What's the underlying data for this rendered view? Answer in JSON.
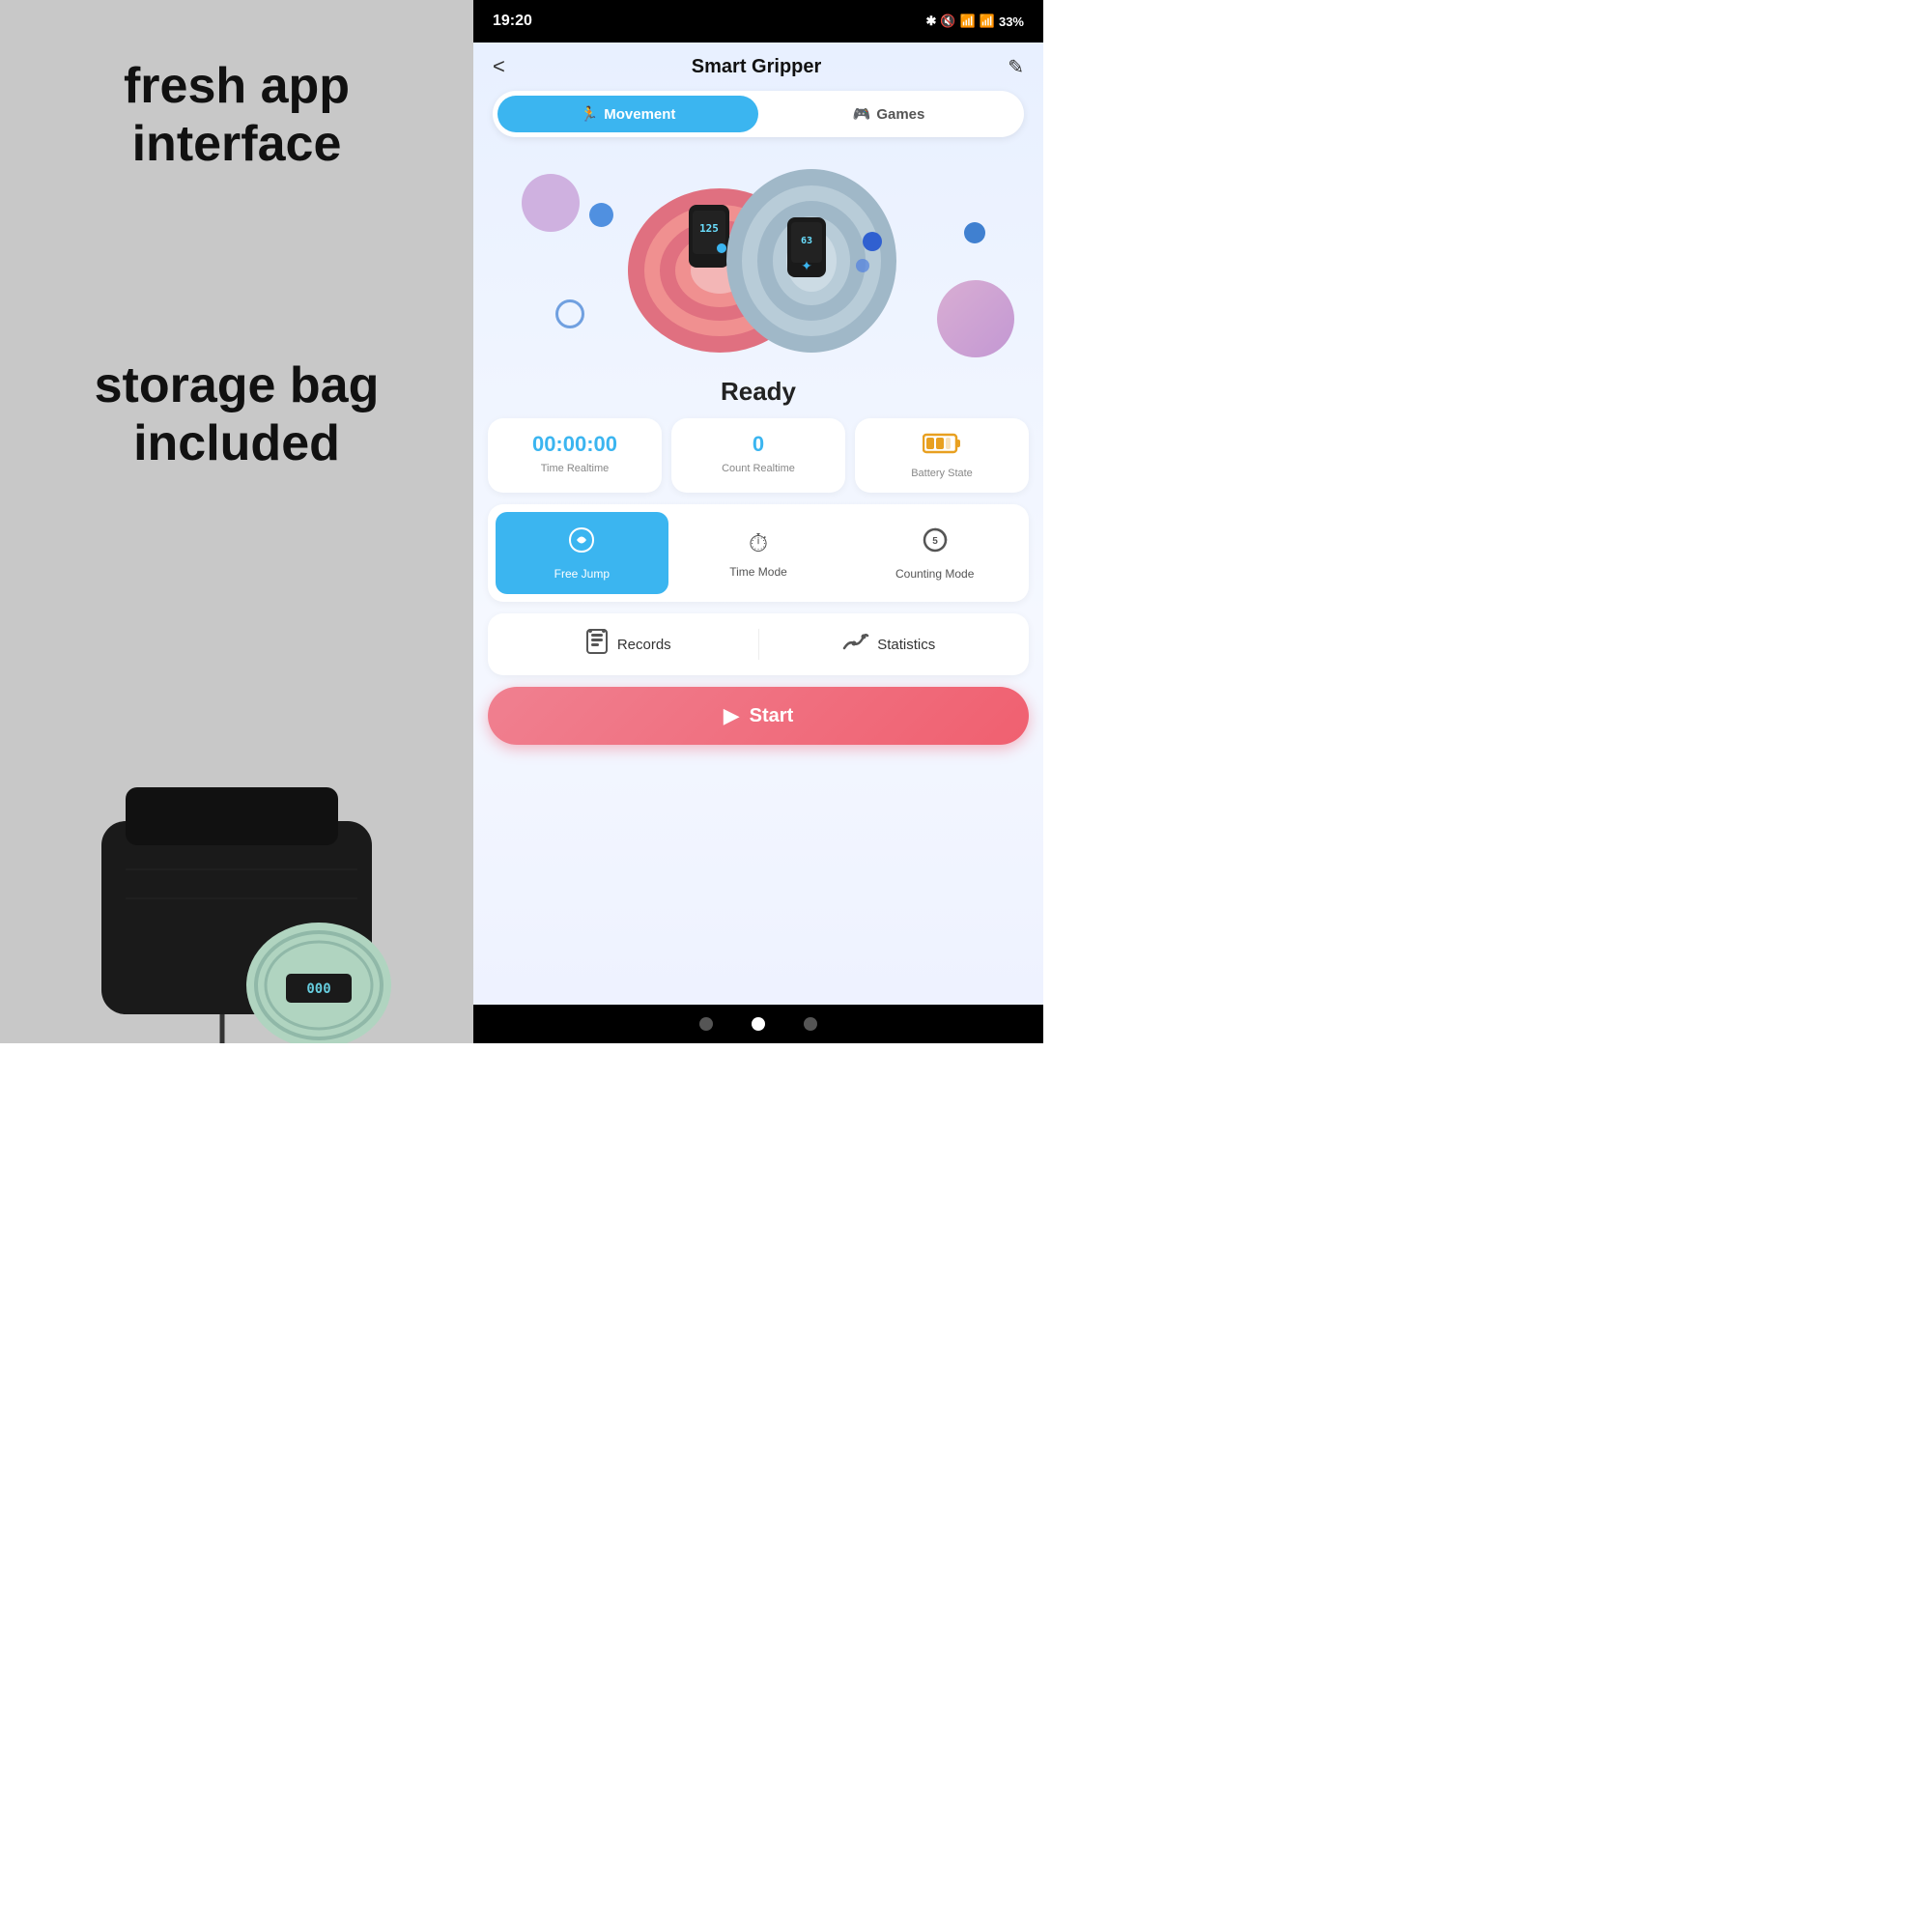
{
  "left": {
    "text_top": "fresh app interface",
    "text_bottom": "storage bag included"
  },
  "status_bar": {
    "time": "19:20",
    "battery": "33%"
  },
  "header": {
    "back": "<",
    "title": "Smart Gripper",
    "edit": "✎"
  },
  "tabs": [
    {
      "id": "movement",
      "label": "Movement",
      "icon": "🏃",
      "active": true
    },
    {
      "id": "games",
      "label": "Games",
      "icon": "🎮",
      "active": false
    }
  ],
  "device_status": "Ready",
  "stats": [
    {
      "id": "time",
      "value": "00:00:00",
      "label": "Time Realtime",
      "type": "text"
    },
    {
      "id": "count",
      "value": "0",
      "label": "Count Realtime",
      "type": "text"
    },
    {
      "id": "battery",
      "label": "Battery State",
      "type": "battery"
    }
  ],
  "modes": [
    {
      "id": "free-jump",
      "label": "Free Jump",
      "icon": "✦",
      "active": true
    },
    {
      "id": "time-mode",
      "label": "Time Mode",
      "icon": "⏱",
      "active": false
    },
    {
      "id": "counting-mode",
      "label": "Counting Mode",
      "icon": "↺",
      "active": false
    }
  ],
  "actions": [
    {
      "id": "records",
      "icon": "📅",
      "label": "Records"
    },
    {
      "id": "statistics",
      "icon": "📈",
      "label": "Statistics"
    }
  ],
  "start_button": {
    "label": "Start",
    "icon": "▶"
  }
}
